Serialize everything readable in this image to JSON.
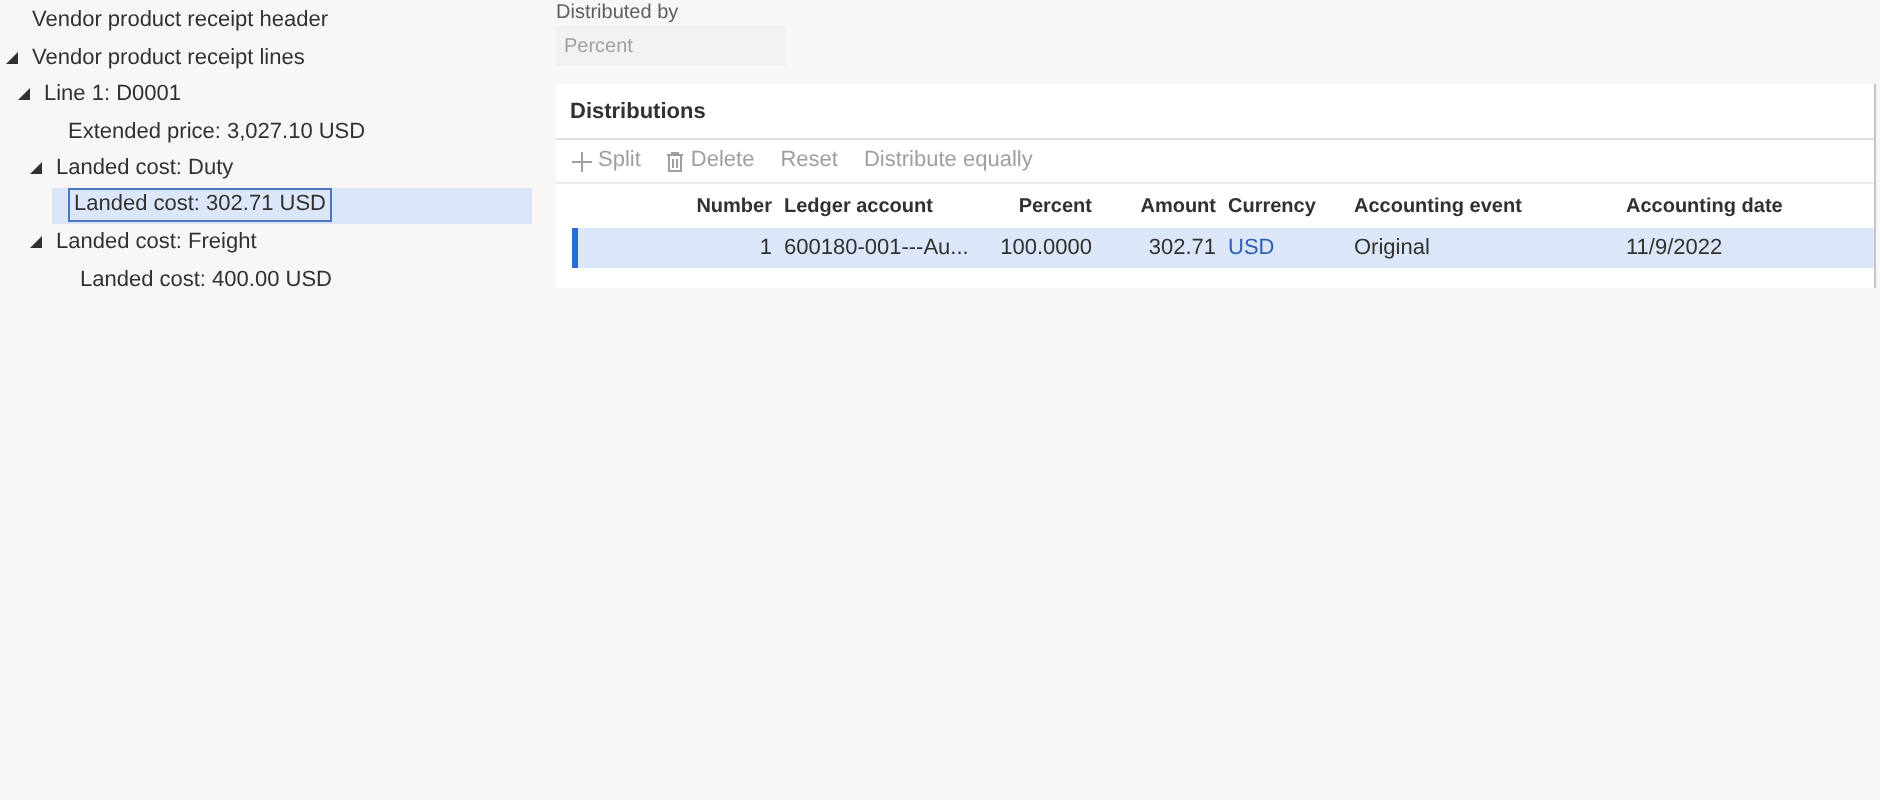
{
  "tree": [
    {
      "label": "Vendor product receipt header",
      "selected": false
    },
    {
      "label": "Vendor product receipt lines",
      "expanded": true,
      "selected": false,
      "children": [
        {
          "label": "Line 1: D0001",
          "expanded": true,
          "selected": false,
          "children": [
            {
              "label": "Extended price: 3,027.10 USD",
              "selected": false
            },
            {
              "label": "Landed cost: Duty",
              "expanded": true,
              "selected": false,
              "children": [
                {
                  "label": "Landed cost: 302.71 USD",
                  "selected": true
                }
              ]
            },
            {
              "label": "Landed cost: Freight",
              "expanded": true,
              "selected": false,
              "children": [
                {
                  "label": "Landed cost: 400.00 USD",
                  "selected": false
                }
              ]
            }
          ]
        }
      ]
    }
  ],
  "distributed_by": {
    "label": "Distributed by",
    "value": "Percent"
  },
  "distributions": {
    "title": "Distributions",
    "toolbar": [
      {
        "kind": "add",
        "label": "Split",
        "disabled": true
      },
      {
        "kind": "delete",
        "label": "Delete",
        "disabled": true
      },
      {
        "kind": "plain",
        "label": "Reset",
        "disabled": true
      },
      {
        "kind": "plain",
        "label": "Distribute equally",
        "disabled": true
      }
    ],
    "columns": [
      "Number",
      "Ledger account",
      "Percent",
      "Amount",
      "Currency",
      "Accounting event",
      "Accounting date"
    ],
    "rows": [
      {
        "cells": [
          "1",
          "600180-001---Au...",
          "100.0000",
          "302.71",
          "USD",
          "Original",
          "11/9/2022"
        ],
        "selected": true
      }
    ]
  }
}
